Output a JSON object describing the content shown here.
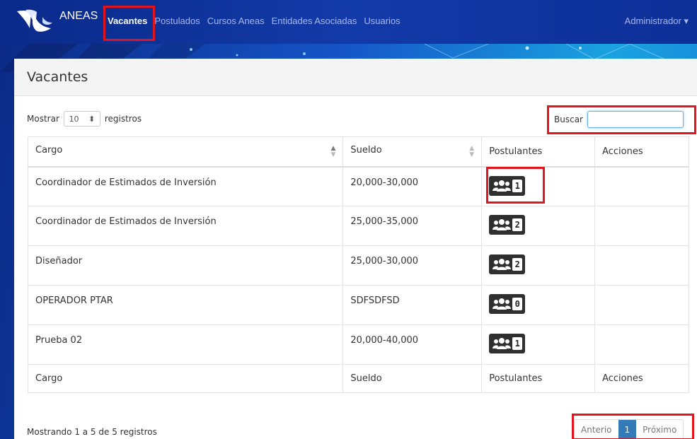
{
  "navbar": {
    "brand": "ANEAS",
    "links": [
      {
        "label": "Vacantes",
        "active": true
      },
      {
        "label": "Postulados",
        "active": false
      },
      {
        "label": "Cursos Aneas",
        "active": false
      },
      {
        "label": "Entidades Asociadas",
        "active": false
      },
      {
        "label": "Usuarios",
        "active": false
      }
    ],
    "user": "Administrador ▾"
  },
  "page": {
    "title": "Vacantes",
    "length": {
      "prefix": "Mostrar",
      "value": "10",
      "suffix": "registros"
    },
    "search": {
      "label": "Buscar",
      "value": ""
    }
  },
  "table": {
    "headers": [
      "Cargo",
      "Sueldo",
      "Postulantes",
      "Acciones"
    ],
    "rows": [
      {
        "cargo": "Coordinador de Estimados de Inversión",
        "sueldo": "20,000-30,000",
        "postulantes": "1",
        "acciones": ""
      },
      {
        "cargo": "Coordinador de Estimados de Inversión",
        "sueldo": "25,000-35,000",
        "postulantes": "2",
        "acciones": ""
      },
      {
        "cargo": "Diseñador",
        "sueldo": "25,000-30,000",
        "postulantes": "2",
        "acciones": ""
      },
      {
        "cargo": "OPERADOR PTAR",
        "sueldo": "SDFSDFSD",
        "postulantes": "0",
        "acciones": ""
      },
      {
        "cargo": "Prueba 02",
        "sueldo": "20,000-40,000",
        "postulantes": "1",
        "acciones": ""
      }
    ]
  },
  "footer": {
    "info": "Mostrando 1 a 5 de 5 registros",
    "pagination": {
      "prev": "Anterio",
      "current": "1",
      "next": "Próximo"
    }
  },
  "colors": {
    "navbar": "#0a2a8a",
    "highlight": "#e0151f",
    "page_active": "#337ab7"
  },
  "icons": {
    "postulantes": "users-icon",
    "sort": "sort-arrows-icon"
  }
}
